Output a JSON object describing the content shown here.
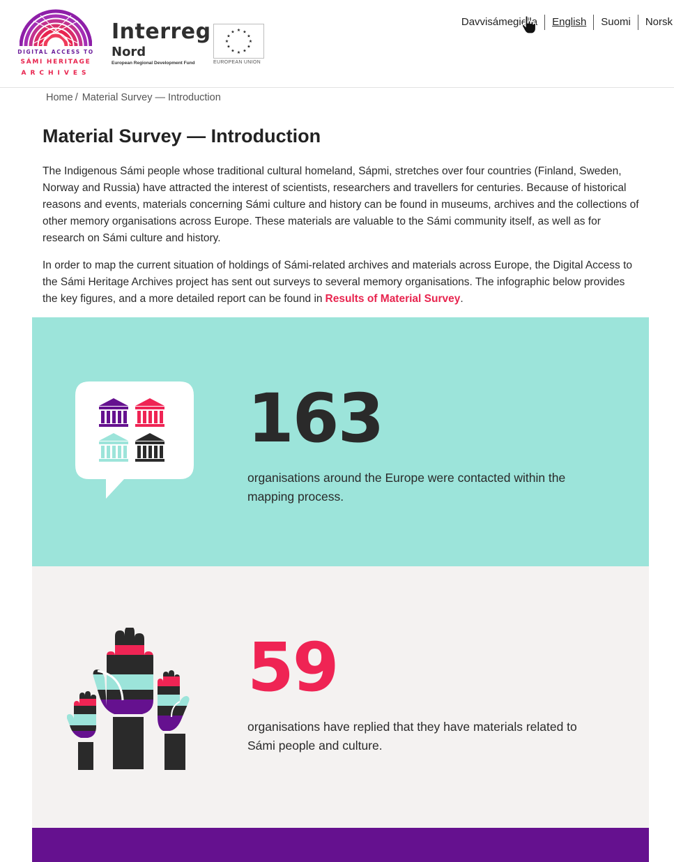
{
  "header": {
    "dasha_logo": {
      "line1": "DIGITAL ACCESS TO",
      "line2": "SÁMI HERITAGE",
      "line3": "ARCHIVES"
    },
    "interreg_logo": {
      "name": "Interreg",
      "region": "Nord",
      "fund": "European Regional Development Fund"
    },
    "eu_logo": {
      "label": "EUROPEAN UNION"
    },
    "languages": [
      {
        "label": "Davvisámegiella",
        "active": false
      },
      {
        "label": "English",
        "active": true
      },
      {
        "label": "Suomi",
        "active": false
      },
      {
        "label": "Norsk",
        "active": false
      }
    ]
  },
  "breadcrumb": {
    "home": "Home",
    "separator": "/",
    "current": "Material Survey — Introduction"
  },
  "main": {
    "title": "Material Survey — Introduction",
    "paragraph1": "The Indigenous Sámi people whose traditional cultural homeland, Sápmi, stretches over four countries (Finland, Sweden, Norway and Russia) have attracted the interest of scientists, researchers and travellers for centuries. Because of historical reasons and events, materials concerning Sámi culture and history can be found in museums, archives and the collections of other memory organisations across Europe. These materials are valuable to the Sámi community itself, as well as for research on Sámi culture and history.",
    "paragraph2_text": "In order to map the current situation of holdings of Sámi-related archives and materials across Europe, the Digital Access to the Sámi Heritage Archives project has sent out surveys to several memory organisations. The infographic below provides the key figures, and a more detailed report can be found in",
    "paragraph2_link": "Results of Material Survey",
    "paragraph2_end": "."
  },
  "infographic": {
    "stat1": {
      "value": "163",
      "text": "organisations around the Europe were contacted within the mapping process.",
      "icon": "museum-buildings-bubble-icon"
    },
    "stat2": {
      "value": "59",
      "text": "organisations have replied that they have materials related to Sámi people and culture.",
      "icon": "raised-hands-icon"
    }
  },
  "colors": {
    "accent": "#e8254f",
    "purple": "#65118f",
    "teal": "#9ce4da",
    "grey_panel": "#f4f2f1",
    "dark": "#2a2a2a"
  }
}
